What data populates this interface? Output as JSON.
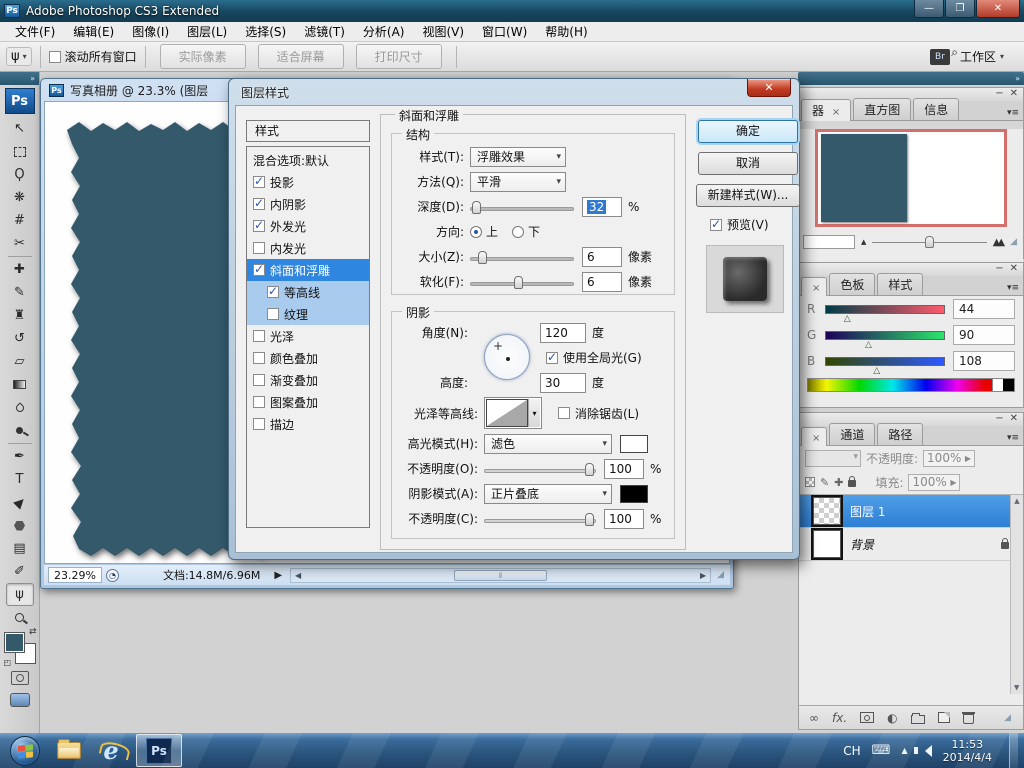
{
  "window": {
    "title": "Adobe Photoshop CS3 Extended"
  },
  "menu": {
    "items": [
      "文件(F)",
      "编辑(E)",
      "图像(I)",
      "图层(L)",
      "选择(S)",
      "滤镜(T)",
      "分析(A)",
      "视图(V)",
      "窗口(W)",
      "帮助(H)"
    ]
  },
  "options_bar": {
    "scroll_all_windows": "滚动所有窗口",
    "actual_pixels": "实际像素",
    "fit_screen": "适合屏幕",
    "print_size": "打印尺寸",
    "workspace": "工作区"
  },
  "document": {
    "title": "写真相册 @ 23.3% (图层",
    "zoom": "23.29%",
    "doc_info": "文档:14.8M/6.96M"
  },
  "dialog": {
    "title": "图层样式",
    "styles_header": "样式",
    "styles": [
      {
        "label": "混合选项:默认"
      },
      {
        "label": "投影"
      },
      {
        "label": "内阴影"
      },
      {
        "label": "外发光"
      },
      {
        "label": "内发光"
      },
      {
        "label": "斜面和浮雕"
      },
      {
        "label": "等高线"
      },
      {
        "label": "纹理"
      },
      {
        "label": "光泽"
      },
      {
        "label": "颜色叠加"
      },
      {
        "label": "渐变叠加"
      },
      {
        "label": "图案叠加"
      },
      {
        "label": "描边"
      }
    ],
    "section_title": "斜面和浮雕",
    "structure": {
      "legend": "结构",
      "style_label": "样式(T):",
      "style_value": "浮雕效果",
      "technique_label": "方法(Q):",
      "technique_value": "平滑",
      "depth_label": "深度(D):",
      "depth_value": "32",
      "depth_unit": "%",
      "direction_label": "方向:",
      "direction_up": "上",
      "direction_down": "下",
      "size_label": "大小(Z):",
      "size_value": "6",
      "size_unit": "像素",
      "soften_label": "软化(F):",
      "soften_value": "6",
      "soften_unit": "像素"
    },
    "shading": {
      "legend": "阴影",
      "angle_label": "角度(N):",
      "angle_value": "120",
      "angle_unit": "度",
      "global_light": "使用全局光(G)",
      "altitude_label": "高度:",
      "altitude_value": "30",
      "altitude_unit": "度",
      "gloss_contour_label": "光泽等高线:",
      "anti_alias": "消除锯齿(L)",
      "highlight_mode_label": "高光模式(H):",
      "highlight_mode_value": "滤色",
      "opacity_highlight_label": "不透明度(O):",
      "opacity_highlight_value": "100",
      "opacity_highlight_unit": "%",
      "shadow_mode_label": "阴影模式(A):",
      "shadow_mode_value": "正片叠底",
      "opacity_shadow_label": "不透明度(C):",
      "opacity_shadow_value": "100",
      "opacity_shadow_unit": "%"
    },
    "buttons": {
      "ok": "确定",
      "cancel": "取消",
      "new_style": "新建样式(W)...",
      "preview": "预览(V)"
    }
  },
  "panels": {
    "navigator": {
      "tab_active": "器",
      "tab2": "直方图",
      "tab3": "信息"
    },
    "color": {
      "tab2": "色板",
      "tab3": "样式",
      "r_label": "R",
      "r_value": "44",
      "g_label": "G",
      "g_value": "90",
      "b_label": "B",
      "b_value": "108"
    },
    "layers": {
      "tab2": "通道",
      "tab3": "路径",
      "opacity_label": "不透明度:",
      "opacity_value": "100%",
      "fill_label": "填充:",
      "fill_value": "100%",
      "layer1_name": "图层 1",
      "background_name": "背景"
    }
  },
  "taskbar": {
    "lang": "CH",
    "time": "11:53",
    "date": "2014/4/4"
  },
  "icons": {
    "collapse": "»",
    "minimize": "—",
    "maximize": "❐",
    "close": "✕",
    "caret_down": "▾",
    "panel_menu": "▾≡",
    "tab_close": "×",
    "move": "↖",
    "lasso": "Ϙ",
    "quick_select": "❋",
    "crop": "#",
    "slice": "✂",
    "healing": "✚",
    "brush": "✎",
    "stamp": "♜",
    "history": "↺",
    "eraser": "▱",
    "pen": "✒",
    "type": "T",
    "path_select": "▶",
    "notes": "▤",
    "eyedropper": "✐",
    "hand": "ψ",
    "swap": "⇄",
    "link": "∞",
    "fx": "fx.",
    "adjustment": "◐",
    "status_play": "▶",
    "left_arrow": "◀",
    "right_arrow": "▶",
    "tri_up": "▲",
    "tri_small": "△",
    "grip": "◢",
    "mt_small": "▲",
    "mt_big": "▲▲",
    "keyboard": "⌨"
  },
  "colors": {
    "canvas_teal": "#33596b",
    "selection_blue": "#2e86e0",
    "navigator_border": "#d3706e",
    "highlight_swatch": "#ffffff",
    "shadow_swatch": "#000000"
  }
}
